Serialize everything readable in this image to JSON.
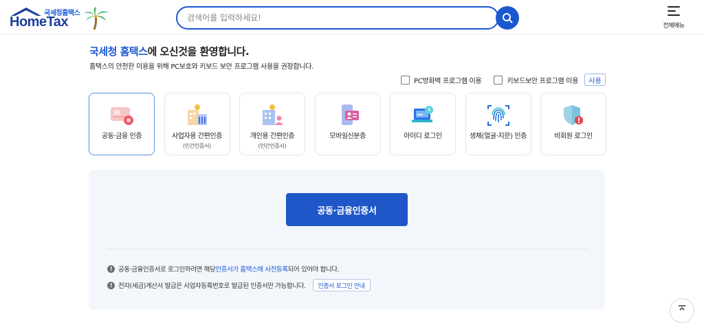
{
  "header": {
    "logo_sub": "국세청홈택스",
    "logo_main": "HomeTax",
    "search_placeholder": "검색어를 입력하세요!",
    "menu_label": "전체메뉴"
  },
  "welcome": {
    "title_highlight": "국세청 홈택스",
    "title_rest": "에 오신것을 환영합니다.",
    "description": "홈택스의 안전한 이용을 위해 PC보호와 키보드 보안 프로그램 사용을 권장합니다."
  },
  "options": {
    "firewall_label": "PC방화벽 프로그램 이용",
    "keyboard_label": "키보드보안 프로그램 이용",
    "use_button": "사용"
  },
  "login_methods": [
    {
      "label": "공동·금융 인증",
      "sub": "",
      "icon": "certificate-card-icon",
      "active": true
    },
    {
      "label": "사업자용 간편인증",
      "sub": "(민간인증서)",
      "icon": "business-building-icon",
      "active": false
    },
    {
      "label": "개인용 간편인증",
      "sub": "(민간인증서)",
      "icon": "personal-building-icon",
      "active": false
    },
    {
      "label": "모바일신분증",
      "sub": "",
      "icon": "mobile-id-icon",
      "active": false
    },
    {
      "label": "아이디 로그인",
      "sub": "",
      "icon": "laptop-login-icon",
      "active": false
    },
    {
      "label": "생체(얼굴·지문) 인증",
      "sub": "",
      "icon": "fingerprint-icon",
      "active": false
    },
    {
      "label": "비회원 로그인",
      "sub": "",
      "icon": "shield-icon",
      "active": false
    }
  ],
  "panel": {
    "cert_button": "공동·금융인증서",
    "note1_a": "공동·금융인증서로 로그인하려면 해당 ",
    "note1_link": "인증서가 홈택스에 사전등록",
    "note1_b": "되어 있어야 합니다.",
    "note2": "전자(세금)계산서 발급은 사업자등록번호로 발급된 인증서만 가능합니다.",
    "guide_button": "인증서 로그인 안내"
  },
  "colors": {
    "primary": "#1a57d1",
    "button": "#1f56c8",
    "panel_bg": "#f3f6fb"
  }
}
